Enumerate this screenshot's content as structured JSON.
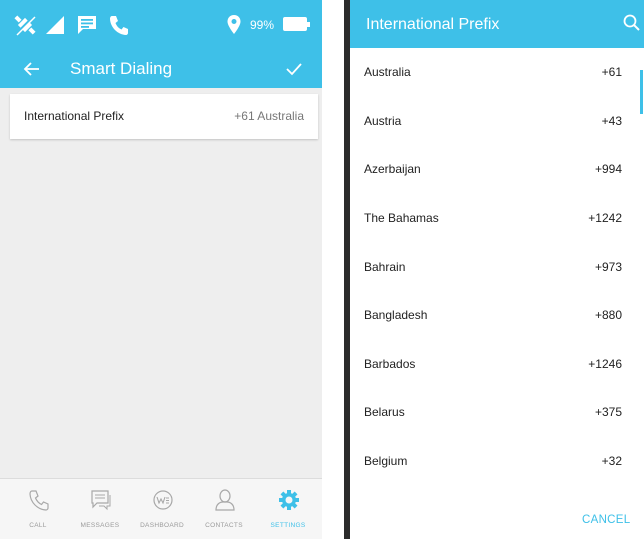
{
  "left_screen": {
    "status_bar": {
      "battery_percent": "99%",
      "icons": [
        "no-gps-icon",
        "signal-icon",
        "message-icon",
        "phone-icon",
        "location-icon",
        "battery-icon"
      ]
    },
    "toolbar": {
      "title": "Smart Dialing",
      "back_icon": "back-arrow-icon",
      "confirm_icon": "check-icon"
    },
    "setting": {
      "label": "International Prefix",
      "value": "+61  Australia"
    },
    "bottom_nav": {
      "items": [
        {
          "label": "CALL",
          "icon": "phone-icon"
        },
        {
          "label": "MESSAGES",
          "icon": "messages-icon"
        },
        {
          "label": "DASHBOARD",
          "icon": "dashboard-icon"
        },
        {
          "label": "CONTACTS",
          "icon": "contacts-icon"
        },
        {
          "label": "SETTINGS",
          "icon": "gear-icon"
        }
      ],
      "active": "SETTINGS"
    }
  },
  "right_screen": {
    "dialog": {
      "title": "International Prefix",
      "search_icon": "search-icon",
      "countries": [
        {
          "name": "Australia",
          "code": "+61"
        },
        {
          "name": "Austria",
          "code": "+43"
        },
        {
          "name": "Azerbaijan",
          "code": "+994"
        },
        {
          "name": "The Bahamas",
          "code": "+1242"
        },
        {
          "name": "Bahrain",
          "code": "+973"
        },
        {
          "name": "Bangladesh",
          "code": "+880"
        },
        {
          "name": "Barbados",
          "code": "+1246"
        },
        {
          "name": "Belarus",
          "code": "+375"
        },
        {
          "name": "Belgium",
          "code": "+32"
        }
      ],
      "cancel_label": "CANCEL"
    }
  },
  "colors": {
    "accent": "#3ec0e8",
    "background": "#eeeeee"
  }
}
